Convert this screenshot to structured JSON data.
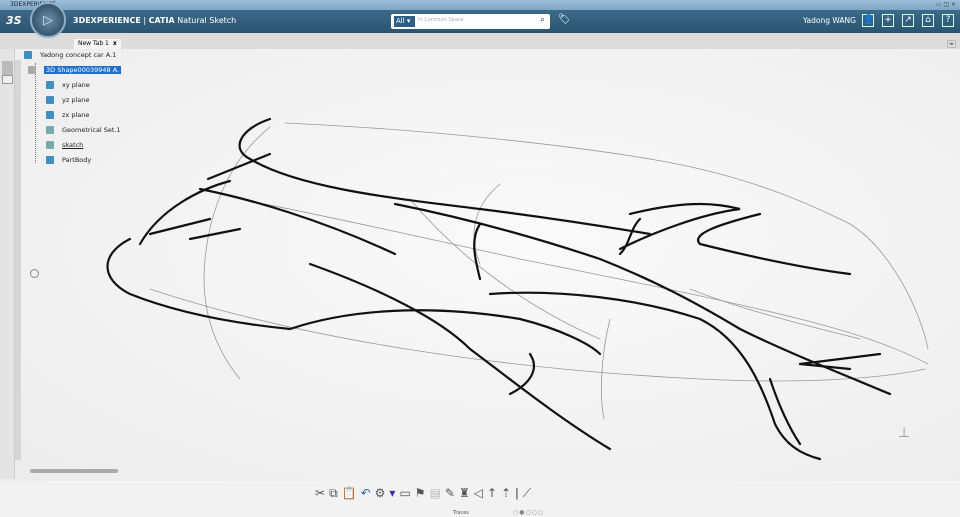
{
  "window_title": "3DEXPERIENCE",
  "header": {
    "brand": "3DEXPERIENCE",
    "separator": " | ",
    "app_brand": "CATIA",
    "app_name": "Natural Sketch",
    "search_scope": "All ▾",
    "search_placeholder": "In Common Space",
    "user": "Yadong WANG"
  },
  "tab": {
    "label": "New Tab 1",
    "close": "x"
  },
  "tree": {
    "root": "Yadong concept car A.1",
    "items": [
      {
        "label": "3D Shape00039948 A."
      },
      {
        "label": "xy plane"
      },
      {
        "label": "yz plane"
      },
      {
        "label": "zx plane"
      },
      {
        "label": "Geometrical Set.1"
      },
      {
        "label": "skatch"
      },
      {
        "label": "PartBody"
      }
    ]
  },
  "toolbar": {
    "section_label": "Traces",
    "page_dots": "○●○○○"
  },
  "colors": {
    "header": "#2e5a76",
    "selection": "#1e6fd0"
  }
}
